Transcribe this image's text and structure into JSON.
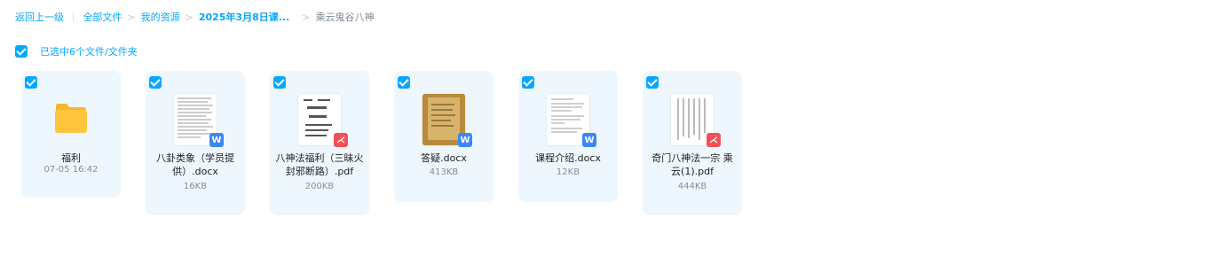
{
  "breadcrumb": {
    "back": "返回上一级",
    "all_files": "全部文件",
    "my_resources": "我的资源",
    "course": "2025年3月8日课...",
    "current": "乘云鬼谷八神"
  },
  "selection": {
    "label": "已选中6个文件/文件夹"
  },
  "items": [
    {
      "name": "福利",
      "meta": "07-05 16:42",
      "type": "folder",
      "icon": "folder-icon",
      "selected": true
    },
    {
      "name": "八卦类象（学员提供）.docx",
      "meta": "16KB",
      "type": "docx",
      "icon": "word-icon",
      "badge": "W",
      "selected": true
    },
    {
      "name": "八神法福利（三昧火 封邪断路）.pdf",
      "meta": "200KB",
      "type": "pdf",
      "icon": "pdf-icon",
      "badge": "⋌",
      "selected": true
    },
    {
      "name": "答疑.docx",
      "meta": "413KB",
      "type": "docx",
      "icon": "word-icon",
      "badge": "W",
      "selected": true
    },
    {
      "name": "课程介绍.docx",
      "meta": "12KB",
      "type": "docx",
      "icon": "word-icon",
      "badge": "W",
      "selected": true
    },
    {
      "name": "奇门八神法一宗 乘云(1).pdf",
      "meta": "444KB",
      "type": "pdf",
      "icon": "pdf-icon",
      "badge": "⋌",
      "selected": true
    }
  ],
  "colors": {
    "accent": "#06a7ff",
    "card_bg": "#eef7fd",
    "word": "#3b87f5",
    "pdf": "#f0515a",
    "folder": "#ffc53d"
  }
}
